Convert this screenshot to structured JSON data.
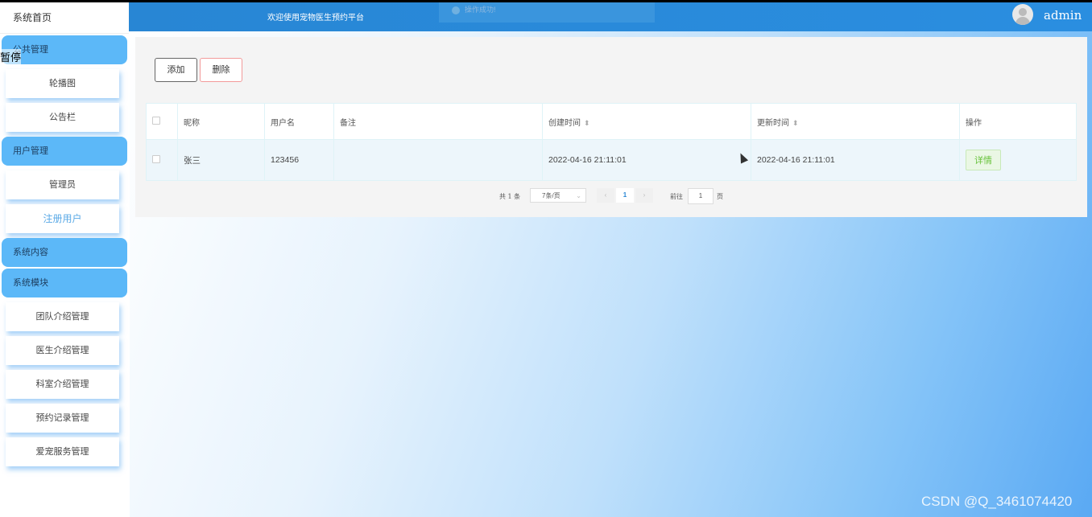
{
  "sidebar": {
    "home": "系统首页",
    "overlay": "暂停",
    "groups": [
      {
        "label": "公共管理",
        "items": [
          "轮播图",
          "公告栏"
        ]
      },
      {
        "label": "用户管理",
        "items": [
          "管理员",
          "注册用户"
        ]
      },
      {
        "label": "系统内容",
        "items": []
      },
      {
        "label": "系统模块",
        "items": [
          "团队介绍管理",
          "医生介绍管理",
          "科室介绍管理",
          "预约记录管理",
          "爱宠服务管理"
        ]
      }
    ]
  },
  "header": {
    "welcome": "欢迎使用宠物医生预约平台",
    "toast": "操作成功!",
    "user": "admin"
  },
  "toolbar": {
    "add": "添加",
    "delete": "删除"
  },
  "table": {
    "headers": [
      "昵称",
      "用户名",
      "备注",
      "创建时间",
      "更新时间",
      "操作"
    ],
    "rows": [
      {
        "nickname": "张三",
        "username": "123456",
        "remark": "",
        "created": "2022-04-16 21:11:01",
        "updated": "2022-04-16 21:11:01",
        "action": "详情"
      }
    ]
  },
  "pagination": {
    "total": "共 1 条",
    "page_size": "7条/页",
    "current": "1",
    "goto_label": "前往",
    "goto_value": "1",
    "page_unit": "页"
  },
  "watermark": "CSDN @Q_3461074420",
  "colors": {
    "header": "#2886d4",
    "sidebar_group": "#5cb8f8",
    "accent": "#2886d4",
    "success": "#67c23a"
  }
}
